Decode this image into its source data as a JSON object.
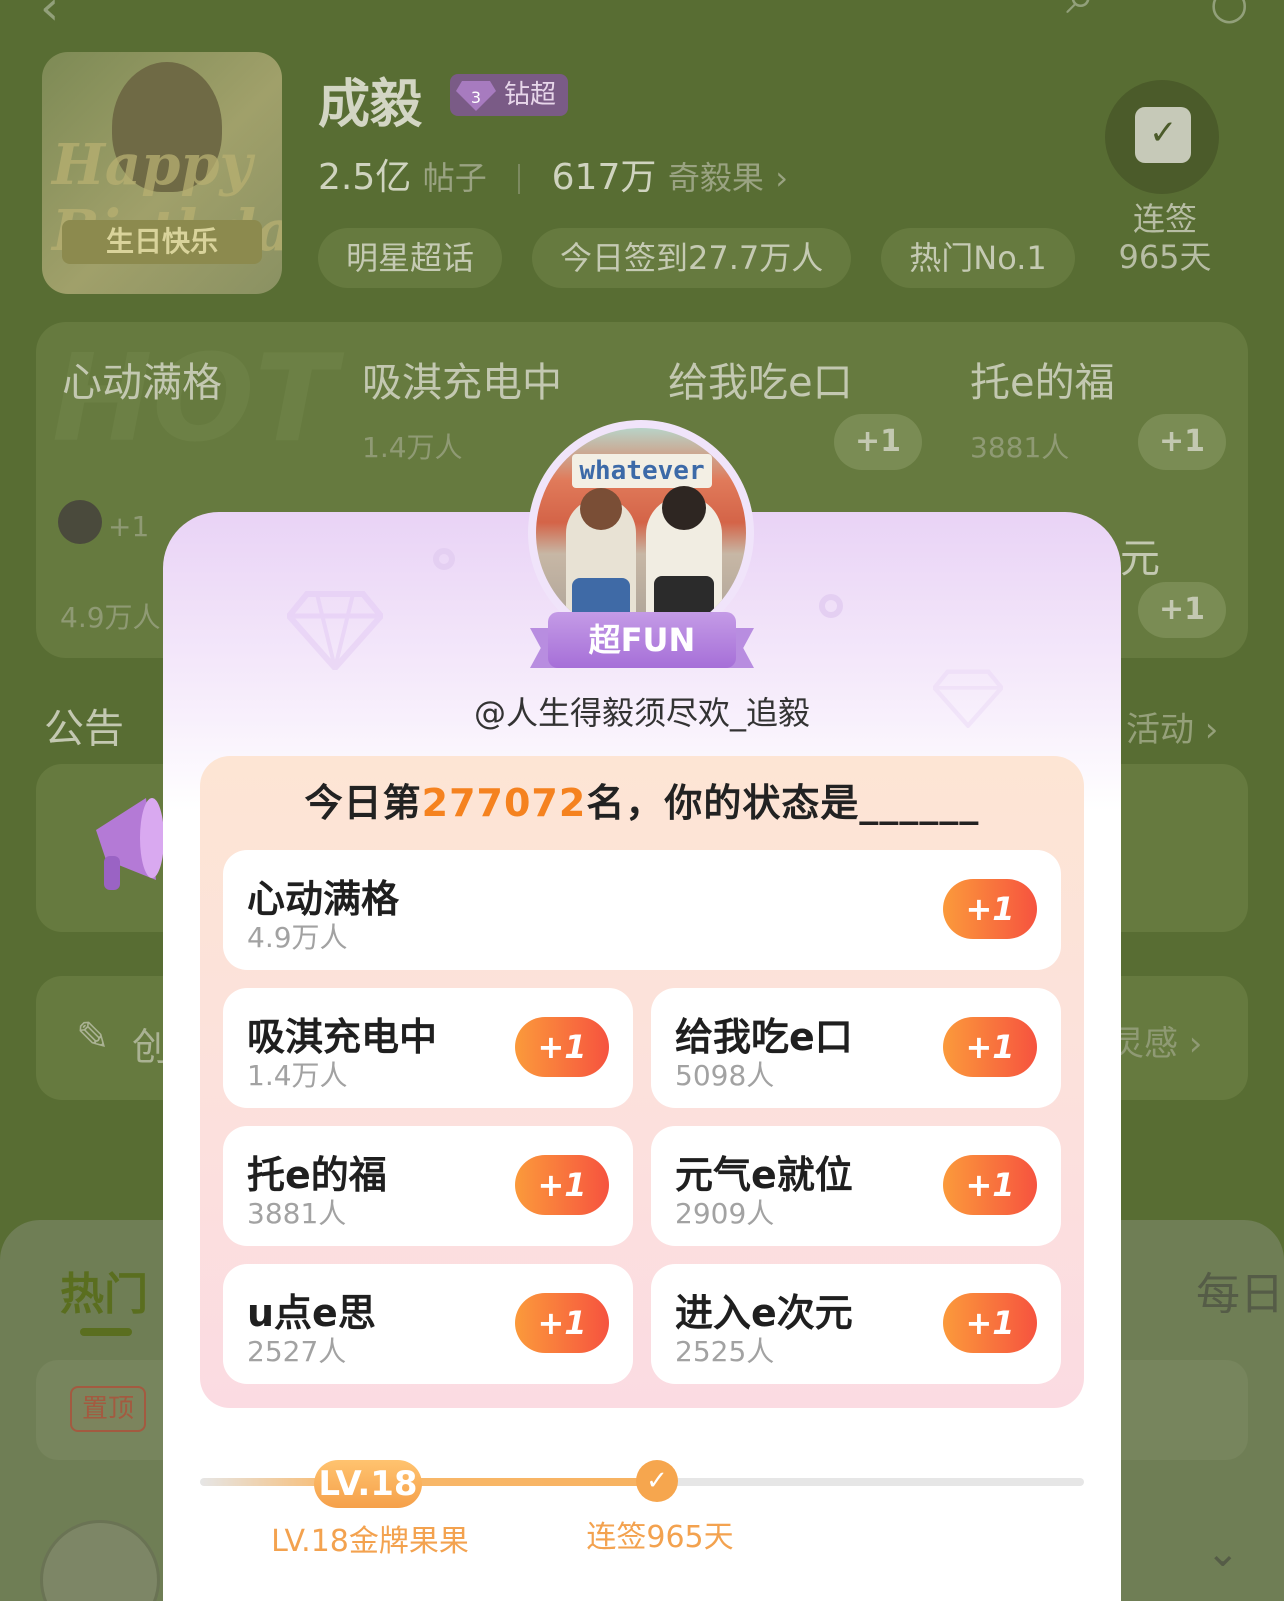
{
  "header": {
    "name": "成毅",
    "vip_level": "3",
    "vip_label": "钻超",
    "avatar_text": "生日快乐",
    "avatar_script": "Happy Birthday",
    "avatar_name": "成毅",
    "posts_value": "2.5亿",
    "posts_unit": "帖子",
    "fans_value": "617万",
    "fans_unit": "奇毅果",
    "fans_chevron": "›",
    "chips": [
      "明星超话",
      "今日签到27.7万人",
      "热门No.1"
    ],
    "checkin_label": "连签",
    "checkin_days": "965天"
  },
  "background_grid": {
    "watermark": "HOT",
    "cells": [
      {
        "title": "心动满格",
        "sub": "4.9万人"
      },
      {
        "title": "吸淇充电中",
        "sub": "1.4万人",
        "plus": "+1"
      },
      {
        "title": "给我吃e口",
        "sub": "5098人",
        "plus": "+1"
      },
      {
        "title": "托e的福",
        "sub": "3881人",
        "plus": "+1"
      },
      {
        "title": "元",
        "plus": "+1"
      }
    ],
    "mini_plus": "+1"
  },
  "background_sections": {
    "announcement": "公告",
    "activity_link": "活动 ›",
    "create_text": "创",
    "create_right": "灵感 ›",
    "tab_hot": "热门",
    "tab_daily": "每日",
    "pinned": "置顶"
  },
  "modal": {
    "badge": "超FUN",
    "avatar_sign": "whatever",
    "username": "@人生得毅须尽欢_追毅",
    "rank_prefix": "今日第",
    "rank_value": "277072",
    "rank_suffix": "名，你的状态是______",
    "options": [
      {
        "name": "心动满格",
        "count": "4.9万人",
        "plus": "+1"
      },
      {
        "name": "吸淇充电中",
        "count": "1.4万人",
        "plus": "+1"
      },
      {
        "name": "给我吃e口",
        "count": "5098人",
        "plus": "+1"
      },
      {
        "name": "托e的福",
        "count": "3881人",
        "plus": "+1"
      },
      {
        "name": "元气e就位",
        "count": "2909人",
        "plus": "+1"
      },
      {
        "name": "u点e思",
        "count": "2527人",
        "plus": "+1"
      },
      {
        "name": "进入e次元",
        "count": "2525人",
        "plus": "+1"
      }
    ],
    "level_pill": "LV.18",
    "level_label": "LV.18金牌果果",
    "streak_label": "连签965天",
    "check_icon": "✓"
  },
  "colors": {
    "accent_orange": "#f5821f",
    "plus_gradient_start": "#fb9a3b",
    "plus_gradient_end": "#f6533f",
    "badge_purple": "#a66fd8",
    "dim_background": "#586d33"
  }
}
